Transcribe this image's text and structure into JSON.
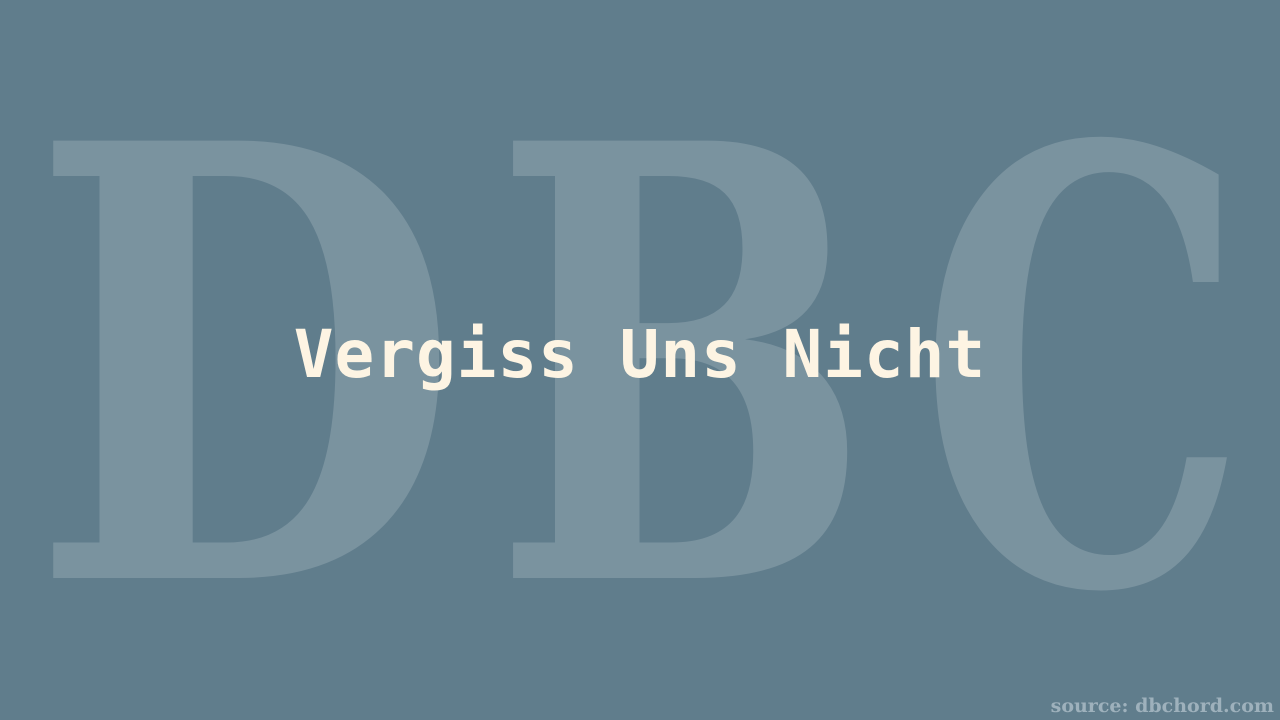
{
  "watermark": {
    "letters": [
      "D",
      "B",
      "C"
    ]
  },
  "title": "Vergiss Uns Nicht",
  "source": "source: dbchord.com",
  "colors": {
    "background": "#607d8c",
    "title": "#fdf4e3",
    "watermark": "#ffffff",
    "source": "#9eb1bc"
  }
}
